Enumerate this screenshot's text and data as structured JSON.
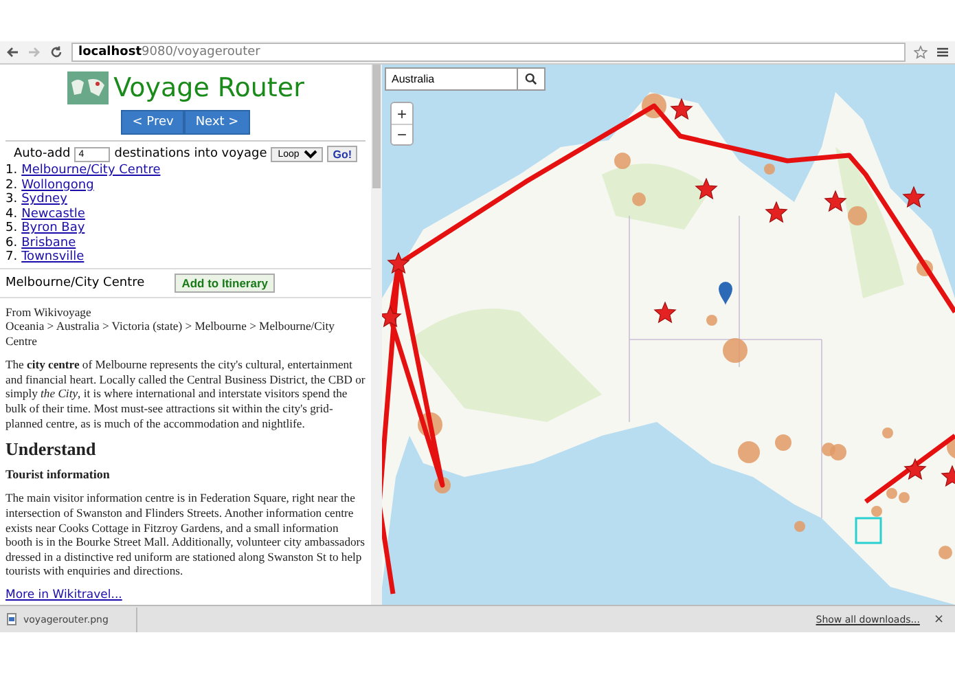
{
  "browser": {
    "url_host": "localhost",
    "url_path": "9080/voyagerouter"
  },
  "app": {
    "title": "Voyage Router",
    "prev": "< Prev",
    "next": "Next >"
  },
  "auto_add": {
    "label": "Auto-add",
    "count": "4",
    "text": "destinations into voyage",
    "mode": "Loop",
    "go": "Go!"
  },
  "destinations": [
    {
      "number": "1.",
      "name": "Melbourne/City Centre"
    },
    {
      "number": "2.",
      "name": "Wollongong"
    },
    {
      "number": "3.",
      "name": "Sydney"
    },
    {
      "number": "4.",
      "name": "Newcastle"
    },
    {
      "number": "5.",
      "name": "Byron Bay"
    },
    {
      "number": "6.",
      "name": "Brisbane"
    },
    {
      "number": "7.",
      "name": "Townsville"
    }
  ],
  "detail": {
    "title": "Melbourne/City Centre",
    "add_button": "Add to Itinerary",
    "source": "From Wikivoyage",
    "breadcrumb": "Oceania > Australia > Victoria (state) > Melbourne > Melbourne/City Centre",
    "intro": "The **city centre** of Melbourne represents the city's cultural, entertainment and financial heart. Locally called the Central Business District, the CBD or simply *the City*, it is where international and interstate visitors spend the bulk of their time. Most must-see attractions sit within the city's grid-planned centre, as is much of the accommodation and nightlife.",
    "heading": "Understand",
    "subheading": "Tourist information",
    "body": "The main visitor information centre is in Federation Square, right near the intersection of Swanston and Flinders Streets. Another information centre exists near Cooks Cottage in Fitzroy Gardens, and a small information booth is in the Bourke Street Mall. Additionally, volunteer city ambassadors dressed in a distinctive red uniform are stationed along Swanston St to help tourists with enquiries and directions.",
    "more_link": "More in Wikitravel..."
  },
  "map": {
    "search": "Australia",
    "zoom_in": "+",
    "zoom_out": "−"
  },
  "downloads": {
    "file": "voyagerouter.png",
    "show_all": "Show all downloads...",
    "close": "×"
  }
}
